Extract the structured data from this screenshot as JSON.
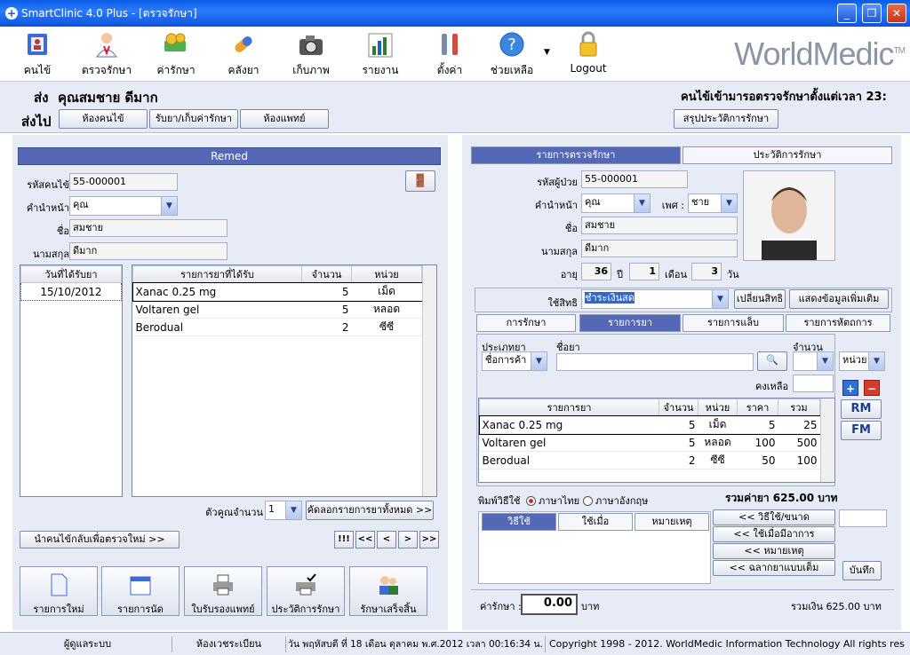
{
  "window": {
    "title": "SmartClinic 4.0 Plus - [ตรวจรักษา]",
    "btn_min": "_",
    "btn_restore": "❐",
    "btn_close": "✕"
  },
  "toolbar": {
    "items": [
      {
        "label": "คนไข้",
        "icon": "patient-book-icon"
      },
      {
        "label": "ตรวจรักษา",
        "icon": "doctor-icon"
      },
      {
        "label": "ค่ารักษา",
        "icon": "money-icon"
      },
      {
        "label": "คลังยา",
        "icon": "pill-icon"
      },
      {
        "label": "เก็บภาพ",
        "icon": "camera-icon"
      },
      {
        "label": "รายงาน",
        "icon": "report-chart-icon"
      },
      {
        "label": "ตั้งค่า",
        "icon": "tools-icon"
      },
      {
        "label": "ช่วยเหลือ",
        "icon": "help-icon"
      },
      {
        "label": "Logout",
        "icon": "lock-icon"
      }
    ],
    "brand": "WorldMedic",
    "brand_tm": "TM"
  },
  "info": {
    "send_label": "ส่ง",
    "patient": "คุณสมชาย ดีมาก",
    "waiting": "คนไข้เข้ามารอตรวจรักษาตั้งแต่เวลา 23:",
    "goto_label": "ส่งไป",
    "goto_buttons": [
      "ห้องคนไข้",
      "รับยา/เก็บค่ารักษา",
      "ห้องแพทย์"
    ],
    "summary_button": "สรุปประวัติการรักษา"
  },
  "left": {
    "header": "Remed",
    "hn_label": "รหัสคนไข้",
    "hn": "55-000001",
    "prefix_label": "คำนำหน้า",
    "prefix": "คุณ",
    "name_label": "ชื่อ",
    "name": "สมชาย",
    "surname_label": "นามสกุล",
    "surname": "ดีมาก",
    "date_header": "วันที่ได้รับยา",
    "dates": [
      "15/10/2012"
    ],
    "cols": [
      "รายการยาที่ได้รับ",
      "จำนวน",
      "หน่วย"
    ],
    "rows": [
      {
        "name": "Xanac 0.25 mg",
        "qty": "5",
        "unit": "เม็ด"
      },
      {
        "name": "Voltaren gel",
        "qty": "5",
        "unit": "หลอด"
      },
      {
        "name": "Berodual",
        "qty": "2",
        "unit": "ซีซี"
      }
    ],
    "multiplier_label": "ตัวคูณจำนวน",
    "multiplier": "1",
    "copy_all": "คัดลอกรายการยาทั้งหมด >>",
    "return_btn": "นำคนไข้กลับเพื่อตรวจใหม่ >>",
    "nav": [
      "!!!",
      "<<",
      "<",
      ">",
      ">>"
    ],
    "actions": [
      "รายการใหม่",
      "รายการนัด",
      "ใบรับรองแพทย์",
      "ประวัติการรักษา",
      "รักษาเสร็จสิ้น"
    ]
  },
  "right": {
    "tabs": [
      "รายการตรวจรักษา",
      "ประวัติการรักษา"
    ],
    "hn_label": "รหัสผู้ป่วย",
    "hn": "55-000001",
    "prefix_label": "คำนำหน้า",
    "prefix": "คุณ",
    "sex_label": "เพศ :",
    "sex": "ชาย",
    "name_label": "ชื่อ",
    "name": "สมชาย",
    "surname_label": "นามสกุล",
    "surname": "ดีมาก",
    "age_label": "อายุ",
    "age_y": "36",
    "y_label": "ปี",
    "age_m": "1",
    "m_label": "เดือน",
    "age_d": "3",
    "d_label": "วัน",
    "rights_label": "ใช้สิทธิ",
    "rights": "ชำระเงินสด",
    "change_rights": "เปลี่ยนสิทธิ",
    "more_info": "แสดงข้อมูลเพิ่มเติม",
    "subtabs": [
      "การรักษา",
      "รายการยา",
      "รายการแล็บ",
      "รายการหัตถการ"
    ],
    "type_label": "ประเภทยา",
    "type": "ชื่อการค้า",
    "drug_label": "ชื่อยา",
    "qty_label": "จำนวน",
    "unit": "หน่วย",
    "remain_label": "คงเหลือ",
    "cols": [
      "รายการยา",
      "จำนวน",
      "หน่วย",
      "ราคา",
      "รวม"
    ],
    "rows": [
      {
        "name": "Xanac 0.25 mg",
        "qty": "5",
        "unit": "เม็ด",
        "price": "5",
        "total": "25"
      },
      {
        "name": "Voltaren gel",
        "qty": "5",
        "unit": "หลอด",
        "price": "100",
        "total": "500"
      },
      {
        "name": "Berodual",
        "qty": "2",
        "unit": "ซีซี",
        "price": "50",
        "total": "100"
      }
    ],
    "rm": "RM",
    "fm": "FM",
    "print_label": "พิมพ์วิธีใช้",
    "lang_th": "ภาษาไทย",
    "lang_en": "ภาษาอังกฤษ",
    "drug_total": "รวมค่ายา 625.00 บาท",
    "usage_tabs": [
      "วิธีใช้",
      "ใช้เมื่อ",
      "หมายเหตุ"
    ],
    "side_btns": [
      "<<      วิธีใช้/ขนาด",
      "<<      ใช้เมื่อมีอาการ",
      "<<      หมายเหตุ",
      "<<      ฉลากยาแบบเต็ม"
    ],
    "save": "บันทึก",
    "fee_label": "ค่ารักษา :",
    "fee": "0.00",
    "baht": "บาท",
    "grand_total": "รวมเงิน 625.00 บาท"
  },
  "status": {
    "user": "ผู้ดูแลระบบ",
    "room": "ห้องเวชระเบียน",
    "datetime": "วัน พฤหัสบดี ที่ 18 เดือน ตุลาคม พ.ศ.2012 เวลา 00:16:34 น.",
    "copyright": "Copyright 1998 - 2012. WorldMedic Information Technology All rights res"
  }
}
